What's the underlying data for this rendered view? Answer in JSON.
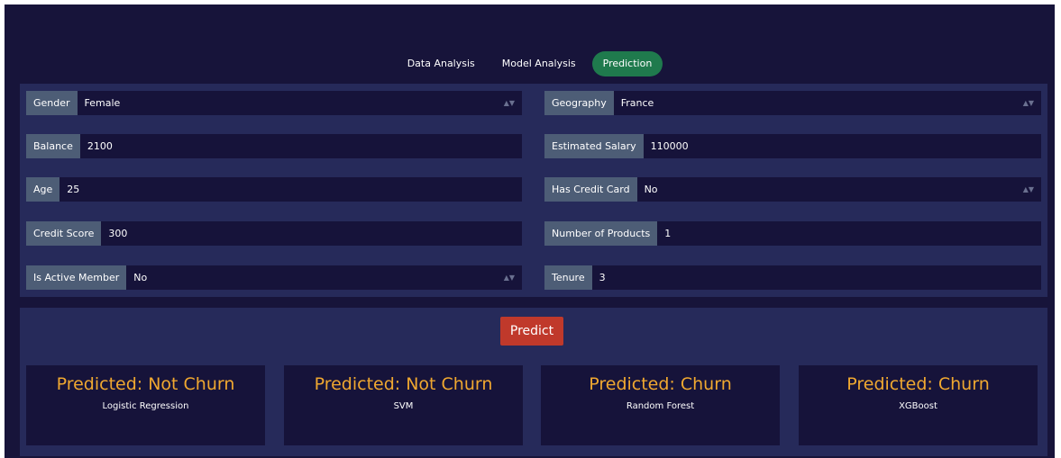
{
  "nav": {
    "tabs": [
      {
        "label": "Data Analysis"
      },
      {
        "label": "Model Analysis"
      },
      {
        "label": "Prediction",
        "active": true
      }
    ]
  },
  "form": {
    "gender": {
      "label": "Gender",
      "value": "Female"
    },
    "geography": {
      "label": "Geography",
      "value": "France"
    },
    "balance": {
      "label": "Balance",
      "value": "2100"
    },
    "estimated_salary": {
      "label": "Estimated Salary",
      "value": "110000"
    },
    "age": {
      "label": "Age",
      "value": "25"
    },
    "has_credit_card": {
      "label": "Has Credit Card",
      "value": "No"
    },
    "credit_score": {
      "label": "Credit Score",
      "value": "300"
    },
    "number_of_products": {
      "label": "Number of Products",
      "value": "1"
    },
    "is_active_member": {
      "label": "Is Active Member",
      "value": "No"
    },
    "tenure": {
      "label": "Tenure",
      "value": "3"
    }
  },
  "predict_button": "Predict",
  "predictions": [
    {
      "result": "Predicted: Not Churn",
      "model": "Logistic Regression"
    },
    {
      "result": "Predicted: Not Churn",
      "model": "SVM"
    },
    {
      "result": "Predicted: Churn",
      "model": "Random Forest"
    },
    {
      "result": "Predicted: Churn",
      "model": "XGBoost"
    }
  ],
  "colors": {
    "background": "#17143a",
    "panel": "#262a5a",
    "active_tab": "#1f7a4d",
    "predict_button": "#c0392b",
    "result_text": "#f0a830"
  }
}
